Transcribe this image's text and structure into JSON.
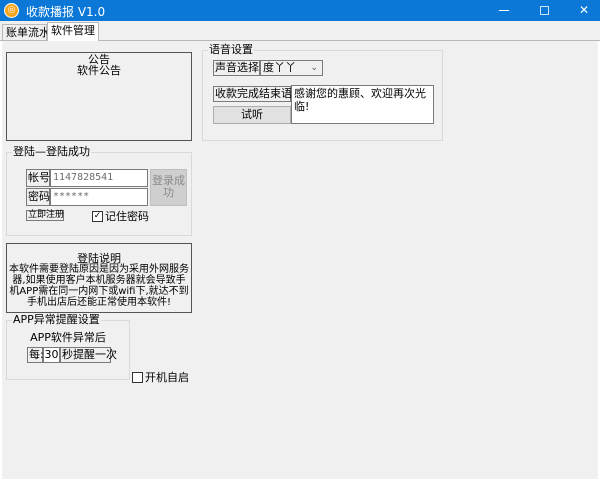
{
  "window": {
    "title": "收款播报 V1.0",
    "app_icon_glyph": "◎",
    "minimize": "minimize-icon",
    "maximize": "maximize-icon",
    "close_glyph": "✕"
  },
  "tabs": [
    {
      "label": "账单流水",
      "active": false
    },
    {
      "label": "软件管理",
      "active": true
    }
  ],
  "notice": {
    "title": "公告",
    "body": "软件公告"
  },
  "voice": {
    "legend": "语音设置",
    "voice_select_label": "声音选择:",
    "voice_selected": "度丫丫",
    "end_phrase_label": "收款完成结束语:",
    "end_phrase_value": "感谢您的惠顾、欢迎再次光临!",
    "try_button": "试听"
  },
  "login": {
    "legend": "登陆—登陆成功",
    "account_label": "帐号:",
    "account_value": "1147828541",
    "password_label": "密码:",
    "password_value": "******",
    "login_button": "登录成功",
    "register_link": "立即注册",
    "remember_label": "记住密码",
    "remember_checked": true
  },
  "explain": {
    "title": "登陆说明",
    "body": "本软件需要登陆原因是因为采用外网服务器,如果使用客户本机服务器就会导致手机APP需在同一内网下或wifi下,就达不到手机出店后还能正常使用本软件!"
  },
  "alert": {
    "legend": "APP异常提醒设置",
    "line1": "APP软件异常后",
    "every_label": "每:",
    "minutes_value": "30",
    "suffix_label": "秒提醒一次"
  },
  "autostart": {
    "label": "开机自启",
    "checked": false
  }
}
